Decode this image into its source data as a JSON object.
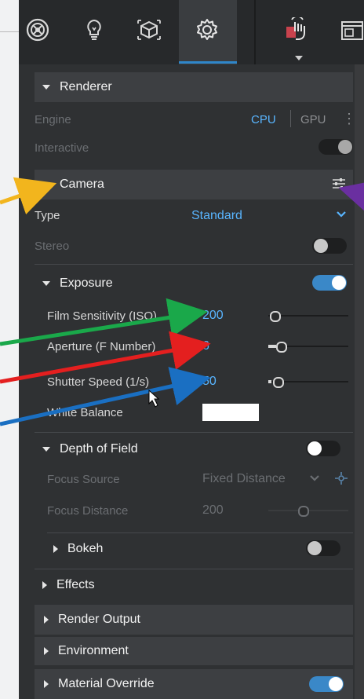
{
  "toolbar": {
    "icons": [
      "scene-icon",
      "lightbulb-icon",
      "material-icon",
      "settings-icon",
      "hand-icon",
      "window-icon"
    ]
  },
  "renderer": {
    "title": "Renderer",
    "engine_label": "Engine",
    "engine_cpu": "CPU",
    "engine_gpu": "GPU",
    "interactive_label": "Interactive"
  },
  "camera": {
    "title": "Camera",
    "type_label": "Type",
    "type_value": "Standard",
    "stereo_label": "Stereo"
  },
  "exposure": {
    "title": "Exposure",
    "iso_label": "Film Sensitivity (ISO)",
    "iso_value": "200",
    "aperture_label": "Aperture (F Number)",
    "aperture_value": "6",
    "shutter_label": "Shutter Speed (1/s)",
    "shutter_value": "50",
    "white_balance_label": "White Balance",
    "white_balance_color": "#ffffff"
  },
  "dof": {
    "title": "Depth of Field",
    "focus_source_label": "Focus Source",
    "focus_source_value": "Fixed Distance",
    "focus_distance_label": "Focus Distance",
    "focus_distance_value": "200",
    "bokeh_title": "Bokeh"
  },
  "sections": {
    "effects": "Effects",
    "render_output": "Render Output",
    "environment": "Environment",
    "material_override": "Material Override"
  },
  "colors": {
    "accent": "#2f86c9",
    "value_blue": "#59b5ff",
    "arrow_orange": "#f2b51d",
    "arrow_green": "#1aa84a",
    "arrow_red": "#e41f1f",
    "arrow_blue": "#1a6fc2",
    "arrow_purple": "#6a2fa0"
  }
}
